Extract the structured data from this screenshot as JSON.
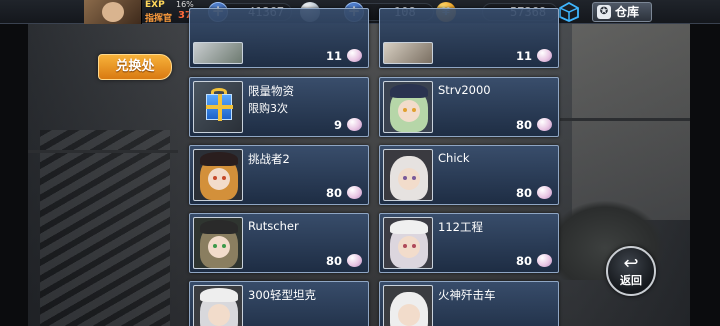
{
  "header": {
    "exp_label": "EXP",
    "exp_percent": "16%",
    "rank_label": "指挥官",
    "level": "37",
    "resource_1": "41367",
    "resource_2": "108",
    "resource_3": "57368",
    "warehouse_label": "仓库"
  },
  "exchange_tab_label": "兑换处",
  "items_left": [
    {
      "name": "",
      "sub": "",
      "price": "11",
      "icon": "crate-icon"
    },
    {
      "name": "限量物资",
      "sub": "限购3次",
      "price": "9",
      "icon": "gift-box-icon"
    },
    {
      "name": "挑战者2",
      "sub": "",
      "price": "80",
      "icon": "challenger2-portrait"
    },
    {
      "name": "Rutscher",
      "sub": "",
      "price": "80",
      "icon": "rutscher-portrait"
    },
    {
      "name": "300轻型坦克",
      "sub": "",
      "price": "",
      "icon": "300-light-tank-portrait"
    }
  ],
  "items_right": [
    {
      "name": "",
      "sub": "",
      "price": "11",
      "icon": "crate-icon"
    },
    {
      "name": "Strv2000",
      "sub": "",
      "price": "80",
      "icon": "strv2000-portrait"
    },
    {
      "name": "Chick",
      "sub": "",
      "price": "80",
      "icon": "chick-portrait"
    },
    {
      "name": "112工程",
      "sub": "",
      "price": "80",
      "icon": "object112-portrait"
    },
    {
      "name": "火神歼击车",
      "sub": "",
      "price": "",
      "icon": "vulcan-td-portrait"
    }
  ],
  "return_label": "返回",
  "colors": {
    "accent_orange": "#d97a12",
    "card_blue": "#2c4466",
    "card_border": "#8fa6c4"
  }
}
